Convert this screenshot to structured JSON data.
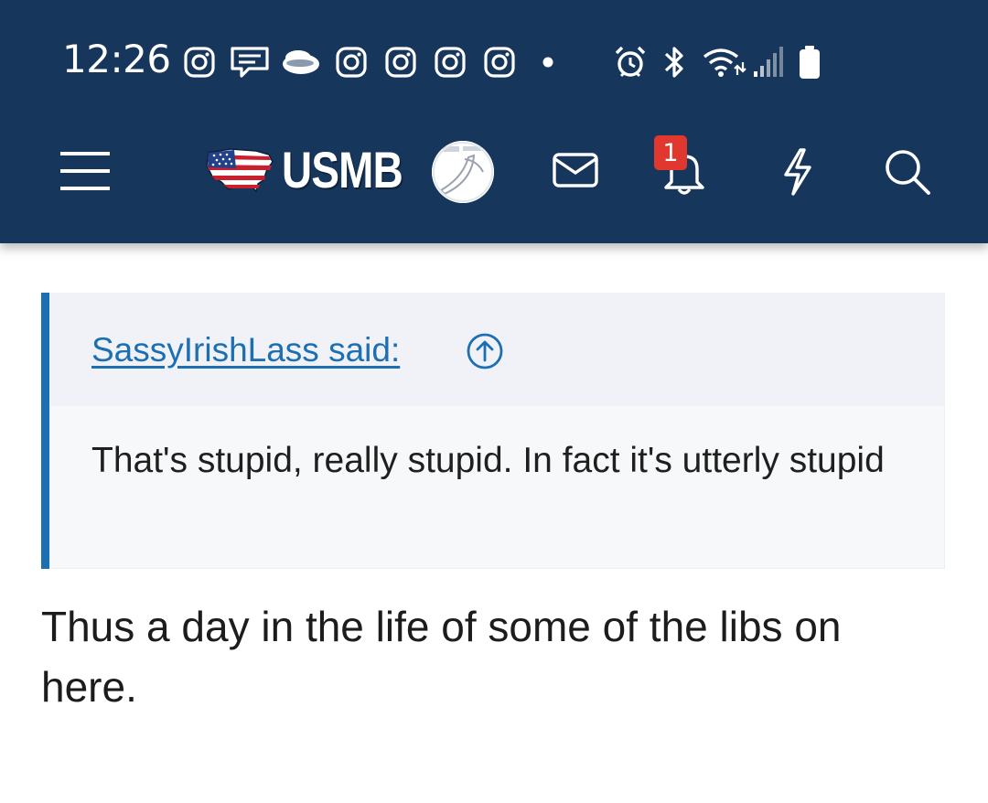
{
  "status_bar": {
    "time": "12:26",
    "notification_icons": [
      "instagram-icon",
      "messages-icon",
      "cloud-icon",
      "instagram-icon",
      "instagram-icon",
      "instagram-icon",
      "instagram-icon"
    ],
    "indicators": [
      "alarm-icon",
      "bluetooth-icon",
      "wifi-icon",
      "signal-icon",
      "battery-icon"
    ]
  },
  "header": {
    "logo_text": "USMB",
    "notification_count": "1",
    "colors": {
      "background": "#17365c",
      "badge": "#e0382e"
    }
  },
  "quote": {
    "author_link": "SassyIrishLass said:",
    "text": "That's stupid, really stupid. In fact it's utterly stupid"
  },
  "post": {
    "text": "Thus a day in the life of some of the libs on here."
  },
  "accent_color": "#1c6fb3"
}
